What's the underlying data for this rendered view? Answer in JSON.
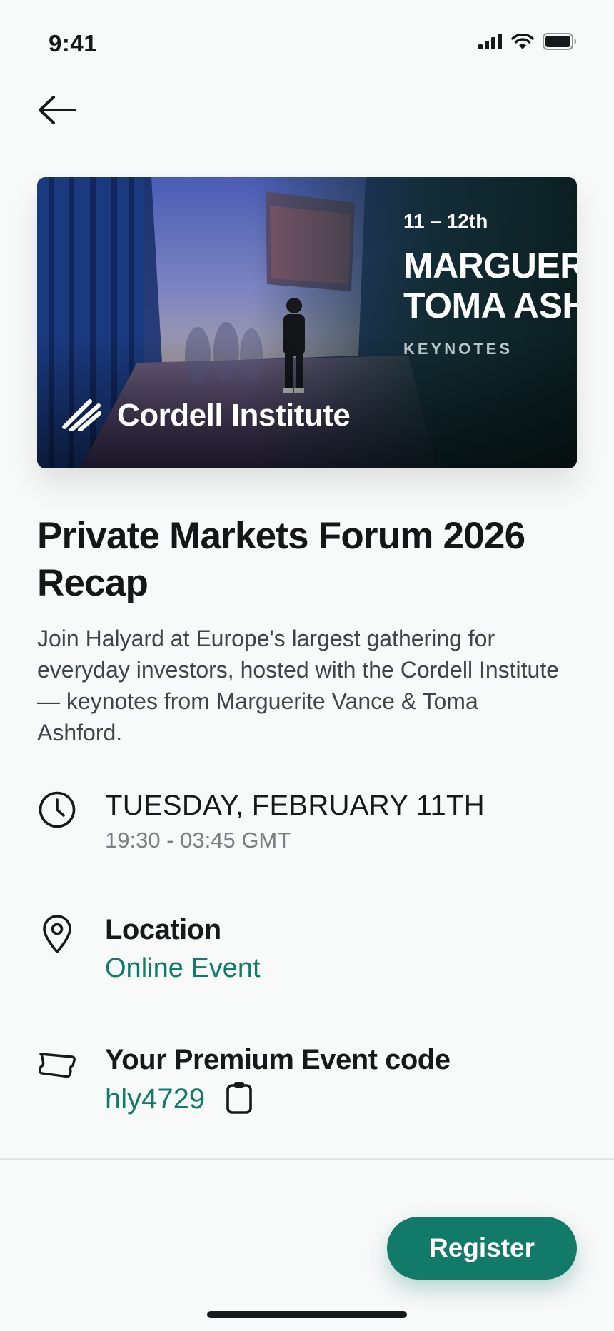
{
  "status_bar": {
    "time": "9:41",
    "icons": [
      "cellular-signal-icon",
      "wifi-icon",
      "battery-icon"
    ]
  },
  "nav": {
    "back_icon": "arrow-left-icon"
  },
  "hero": {
    "date_range": "11 – 12th",
    "speakers_line1": "MARGUERITE",
    "speakers_line2": "TOMA ASHFORD",
    "tag": "KEYNOTES",
    "brand_name": "Cordell Institute",
    "brand_icon": "cordell-logo-icon"
  },
  "event": {
    "title": "Private Markets Forum 2026 Recap",
    "description": "Join Halyard at Europe's largest gathering for everyday investors, hosted with the Cordell Institute — keynotes from Marguerite Vance & Toma Ashford."
  },
  "date_info": {
    "icon": "clock-icon",
    "date": "TUESDAY, FEBRUARY 11TH",
    "time": "19:30 - 03:45 GMT"
  },
  "location_info": {
    "icon": "map-pin-icon",
    "label": "Location",
    "value": "Online Event"
  },
  "code_info": {
    "icon": "ticket-icon",
    "label": "Your Premium Event code",
    "code": "hly4729",
    "copy_icon": "clipboard-icon"
  },
  "actions": {
    "register_label": "Register"
  },
  "colors": {
    "accent": "#127a68",
    "background": "#f8f9f9",
    "text_primary": "#16181a",
    "text_secondary": "#7a7f84"
  }
}
